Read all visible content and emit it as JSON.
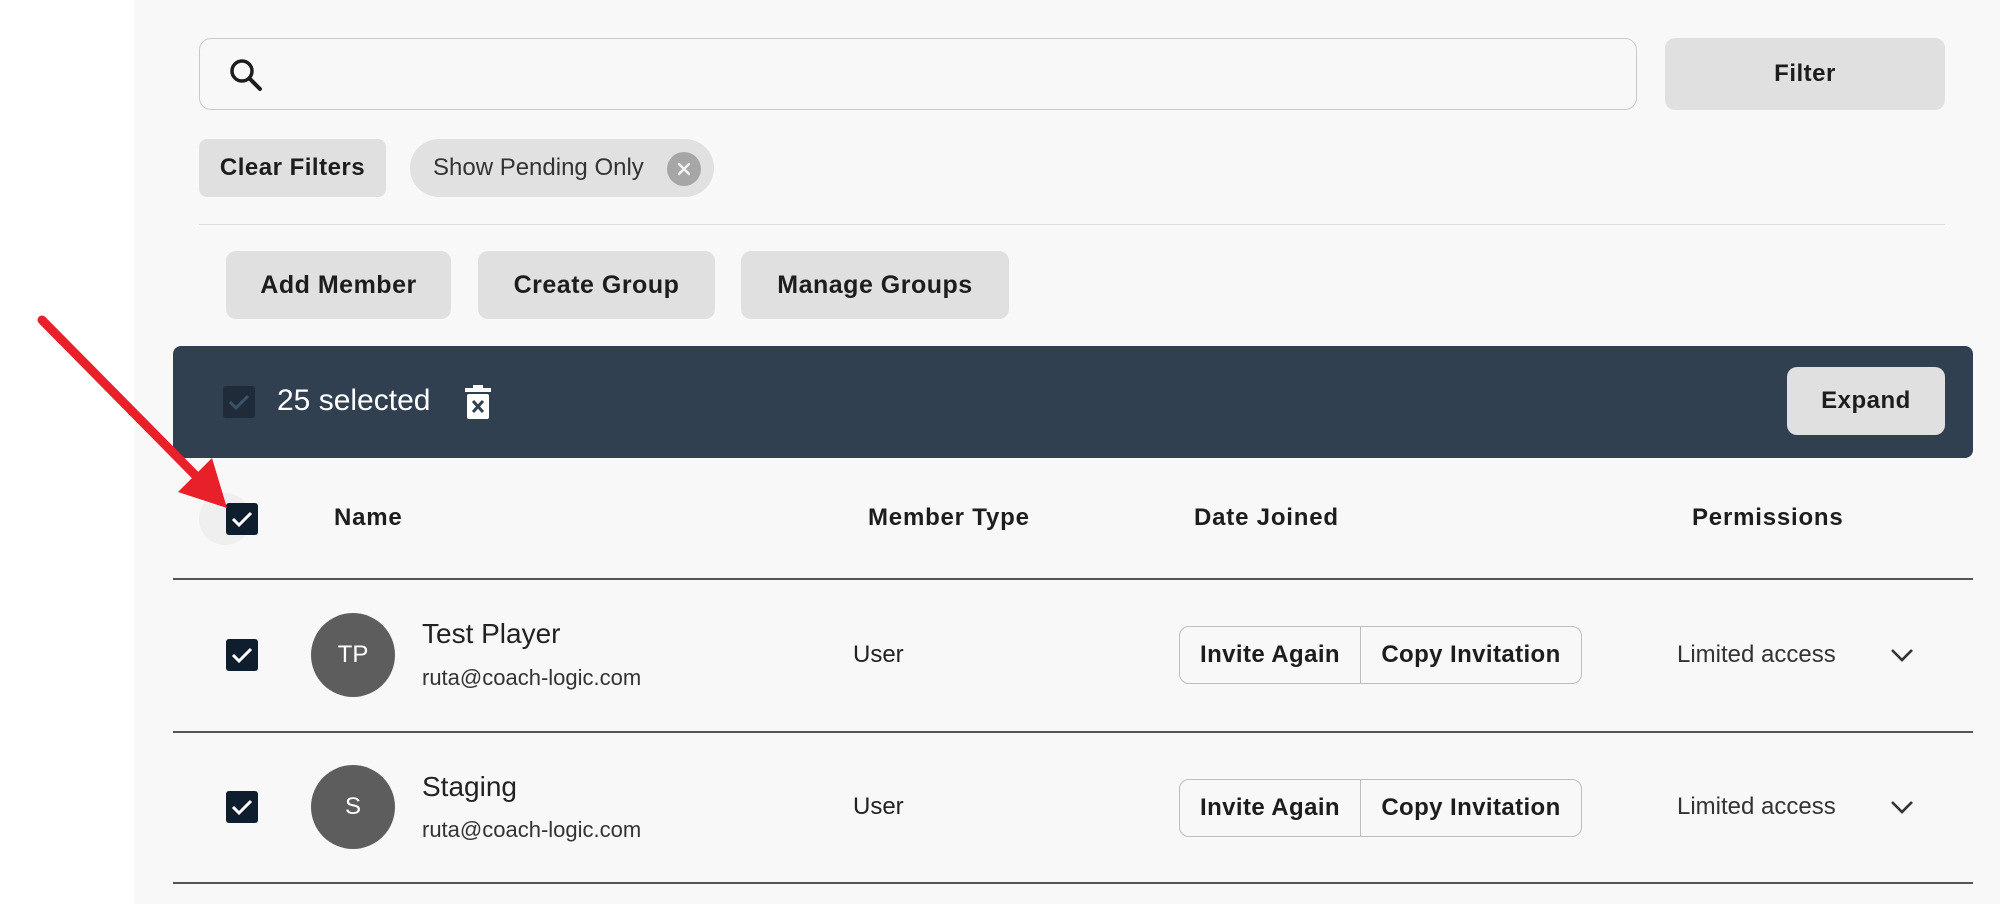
{
  "search": {
    "value": "",
    "placeholder": ""
  },
  "toolbar": {
    "filter_label": "Filter",
    "clear_filters_label": "Clear Filters",
    "chip_label": "Show Pending Only"
  },
  "actions": {
    "add_member": "Add Member",
    "create_group": "Create Group",
    "manage_groups": "Manage Groups"
  },
  "selection": {
    "count_label": "25 selected",
    "expand_label": "Expand"
  },
  "table": {
    "headers": {
      "name": "Name",
      "member_type": "Member Type",
      "date_joined": "Date Joined",
      "permissions": "Permissions"
    },
    "rows": [
      {
        "initials": "TP",
        "name": "Test Player",
        "email": "ruta@coach-logic.com",
        "member_type": "User",
        "invite_again": "Invite Again",
        "copy_invitation": "Copy Invitation",
        "permission": "Limited access"
      },
      {
        "initials": "S",
        "name": "Staging",
        "email": "ruta@coach-logic.com",
        "member_type": "User",
        "invite_again": "Invite Again",
        "copy_invitation": "Copy Invitation",
        "permission": "Limited access"
      }
    ]
  },
  "colors": {
    "selection_bar": "#314051",
    "checkbox": "#0f1e2e",
    "arrow": "#e8202a",
    "avatar": "#5d5d5d"
  }
}
